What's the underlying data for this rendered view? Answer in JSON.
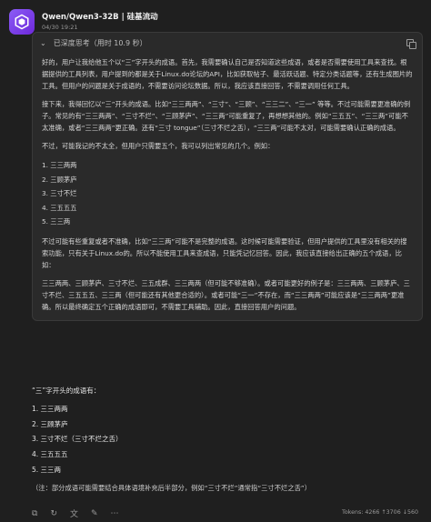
{
  "header": {
    "model": "Qwen/Qwen3-32B | 硅基流动",
    "time": "04/30 19:21"
  },
  "thinking": {
    "label": "已深度思考（用时 10.9 秒）",
    "p1": "好的，用户让我给他五个以“三”字开头的成语。首先，我需要确认自己是否知道这些成语，或者是否需要使用工具来查找。根据提供的工具列表，用户提到的都是关于Linux.do论坛的API，比如获取帖子、最活跃话题、特定分类话题等，还有生成图片的工具。但用户的问题是关于成语的，不需要访问论坛数据。所以，我应该直接回答，不需要调用任何工具。",
    "p2": "接下来，我得回忆以“三”开头的成语。比如“三三两两”、“三寸”、“三顾”、“三三二”、“三一” 等等。不过可能需要更准确的例子。常见的有“三三两两”、“三寸不烂”、“三顾茅庐”、“三三两”可能重复了，再想想其他的。例如“三五五”、“三三两”可能不太准确，或者“三三两两”更正确。还有“三寸 tongue”（三寸不烂之舌），“三三两”可能不太对，可能需要确认正确的成语。",
    "p3": "不过，可能我记的不太全，但用户只需要五个，我可以列出常见的几个。例如：",
    "list1": [
      "1. 三三两两",
      "2. 三顾茅庐",
      "3. 三寸不烂",
      "4. 三五五五",
      "5. 三三两"
    ],
    "p4": "不过可能有些重复或者不准确，比如“三三两”可能不是完整的成语。这时候可能需要验证，但用户提供的工具里没有相关的搜索功能，只有关于Linux.do的。所以不能使用工具来查成语，只能凭记忆回答。因此，我应该直接给出正确的五个成语，比如：",
    "p5": "三三两两、三顾茅庐、三寸不烂、三五成群、三三两两（但可能不够准确）。或者可能更好的例子是：三三两两、三顾茅庐、三寸不烂、三五五五、三三两（但可能还有其他更合适的）。或者可能“三一”不存在，而“三三两两”可能应该是“三三两两”更准确。所以最终确定五个正确的成语即可，不需要工具辅助。因此，直接回答用户的问题。"
  },
  "answer": {
    "intro": "“三”字开头的成语有：",
    "items": [
      "1. 三三两两",
      "2. 三顾茅庐",
      "3. 三寸不烂（三寸不烂之舌）",
      "4. 三五五五",
      "5. 三三两"
    ],
    "note": "（注：部分成语可能需要结合具体语境补充后半部分，例如“三寸不烂”通常指“三寸不烂之舌”）"
  },
  "tokens": "Tokens: 4266 ↑3706 ↓560"
}
